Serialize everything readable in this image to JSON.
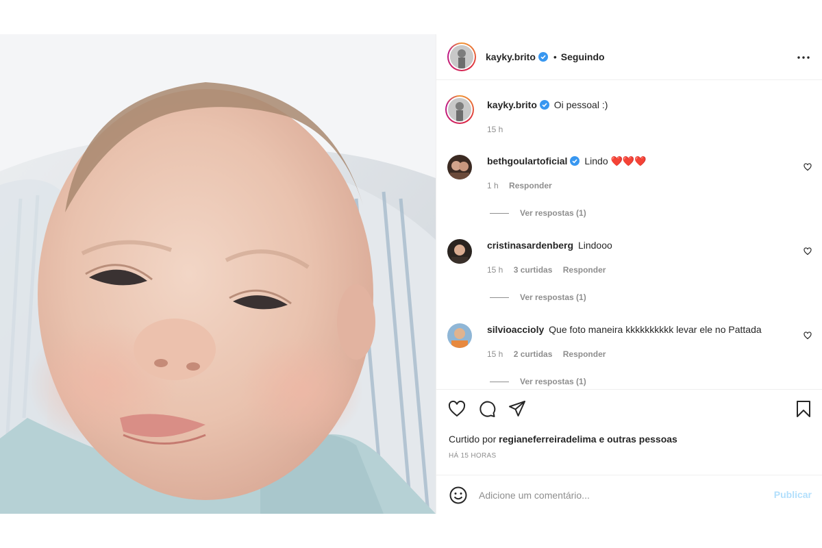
{
  "post": {
    "author": "kayky.brito",
    "following_label": "Seguindo",
    "separator": "•",
    "caption": {
      "username": "kayky.brito",
      "text": "Oi pessoal :)",
      "time": "15 h"
    },
    "comments": [
      {
        "username": "bethgoulartoficial",
        "verified": true,
        "text": "Lindo ❤️❤️❤️",
        "time": "1 h",
        "likes": "",
        "reply_label": "Responder",
        "view_replies": "Ver respostas (1)"
      },
      {
        "username": "cristinasardenberg",
        "verified": false,
        "text": "Lindooo",
        "time": "15 h",
        "likes": "3 curtidas",
        "reply_label": "Responder",
        "view_replies": "Ver respostas (1)"
      },
      {
        "username": "silvioaccioly",
        "verified": false,
        "text": "Que foto maneira kkkkkkkkkk levar ele no Pattada",
        "time": "15 h",
        "likes": "2 curtidas",
        "reply_label": "Responder",
        "view_replies": "Ver respostas (1)"
      }
    ],
    "liked_by": {
      "prefix": "Curtido por",
      "user": "regianeferreiradelima",
      "suffix": "e outras pessoas"
    },
    "time_ago": "HÁ 15 HORAS",
    "add_comment": {
      "placeholder": "Adicione um comentário...",
      "publish_label": "Publicar"
    }
  },
  "colors": {
    "verified": "#3897f0",
    "publish_disabled": "#b2dffc",
    "heart_emoji": "#e0245e"
  },
  "icons": {
    "more": "more-horizontal-icon",
    "like": "heart-outline-icon",
    "comment": "comment-icon",
    "share": "paper-plane-icon",
    "save": "bookmark-icon",
    "emoji": "emoji-smile-icon"
  }
}
